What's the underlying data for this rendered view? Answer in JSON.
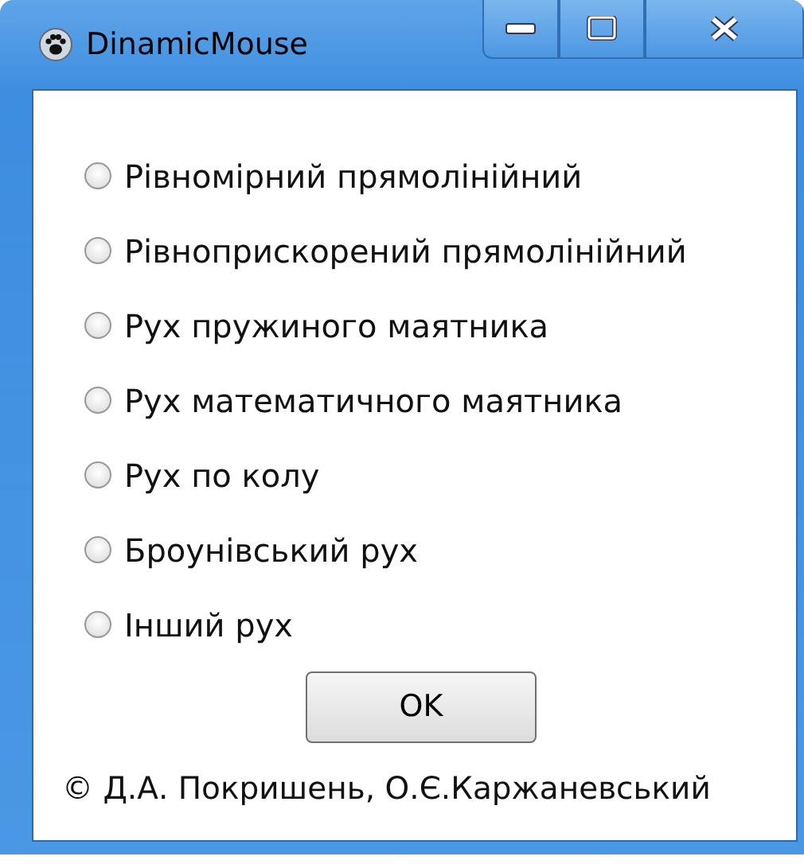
{
  "window": {
    "title": "DinamicMouse"
  },
  "options": [
    {
      "label": "Рівномірний прямолінійний",
      "selected": false
    },
    {
      "label": "Рівноприскорений прямолінійний",
      "selected": false
    },
    {
      "label": "Рух пружиного маятника",
      "selected": false
    },
    {
      "label": "Рух математичного маятника",
      "selected": false
    },
    {
      "label": "Рух по колу",
      "selected": false
    },
    {
      "label": "Броунівський рух",
      "selected": false
    },
    {
      "label": "Інший рух",
      "selected": false
    }
  ],
  "ok_button": "OK",
  "footer": "© Д.А. Покришень, О.Є.Каржаневський"
}
